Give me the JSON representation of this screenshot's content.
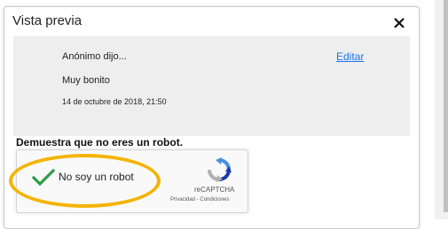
{
  "dialog": {
    "title": "Vista previa",
    "close_icon": "close-icon"
  },
  "preview": {
    "author": "Anónimo dijo...",
    "edit_label": "Editar",
    "comment": "Muy bonito",
    "date": "14 de octubre de 2018, 21:50"
  },
  "robot_prompt": "Demuestra que no eres un robot.",
  "captcha": {
    "label": "No soy un robot",
    "checked": true,
    "brand": "reCAPTCHA",
    "privacy": "Privacidad",
    "separator": " - ",
    "terms": "Condiciones",
    "check_color": "#2e9e47",
    "highlight_color": "#f4b400"
  }
}
